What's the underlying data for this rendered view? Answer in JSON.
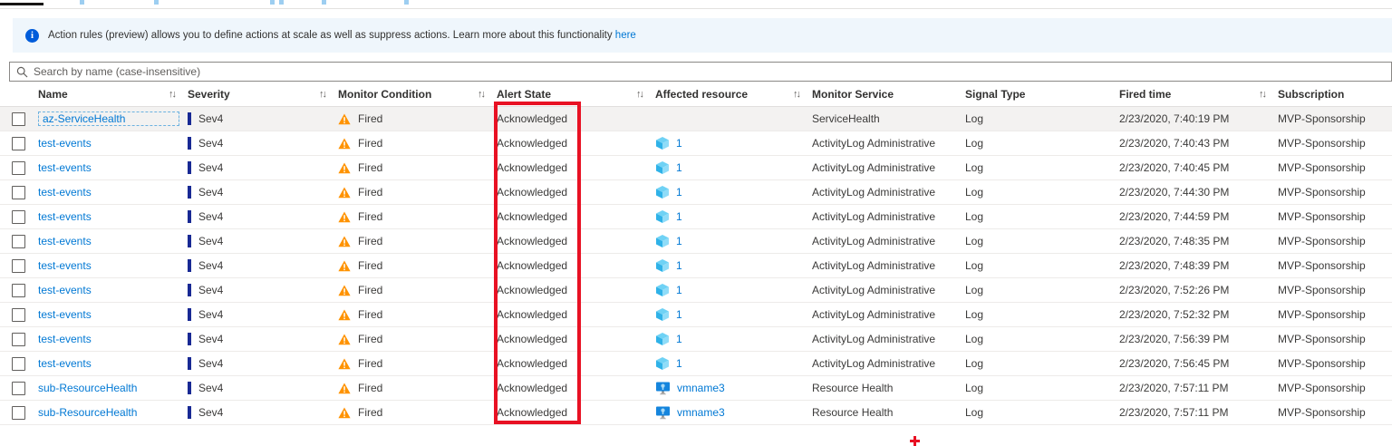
{
  "banner": {
    "message": "Action rules (preview) allows you to define actions at scale as well as suppress actions. Learn more about this functionality",
    "link_label": "here",
    "background": "#eff6fc",
    "info_icon": "info-icon"
  },
  "search": {
    "placeholder": "Search by name (case-insensitive)",
    "icon": "search-icon"
  },
  "table": {
    "sort_glyph": "↑↓",
    "columns": [
      {
        "label": "Name",
        "sortable": true
      },
      {
        "label": "Severity",
        "sortable": true
      },
      {
        "label": "Monitor Condition",
        "sortable": true
      },
      {
        "label": "Alert State",
        "sortable": true
      },
      {
        "label": "Affected resource",
        "sortable": true
      },
      {
        "label": "Monitor Service",
        "sortable": false
      },
      {
        "label": "Signal Type",
        "sortable": false
      },
      {
        "label": "Fired time",
        "sortable": true
      },
      {
        "label": "Subscription",
        "sortable": false
      }
    ],
    "rows": [
      {
        "selected": true,
        "name": "az-ServiceHealth",
        "severity": "Sev4",
        "condition": "Fired",
        "state": "Acknowledged",
        "resource": {
          "type": null,
          "label": ""
        },
        "service": "ServiceHealth",
        "signal": "Log",
        "fired": "2/23/2020, 7:40:19 PM",
        "subscription": "MVP-Sponsorship"
      },
      {
        "selected": false,
        "name": "test-events",
        "severity": "Sev4",
        "condition": "Fired",
        "state": "Acknowledged",
        "resource": {
          "type": "cube",
          "label": "1"
        },
        "service": "ActivityLog Administrative",
        "signal": "Log",
        "fired": "2/23/2020, 7:40:43 PM",
        "subscription": "MVP-Sponsorship"
      },
      {
        "selected": false,
        "name": "test-events",
        "severity": "Sev4",
        "condition": "Fired",
        "state": "Acknowledged",
        "resource": {
          "type": "cube",
          "label": "1"
        },
        "service": "ActivityLog Administrative",
        "signal": "Log",
        "fired": "2/23/2020, 7:40:45 PM",
        "subscription": "MVP-Sponsorship"
      },
      {
        "selected": false,
        "name": "test-events",
        "severity": "Sev4",
        "condition": "Fired",
        "state": "Acknowledged",
        "resource": {
          "type": "cube",
          "label": "1"
        },
        "service": "ActivityLog Administrative",
        "signal": "Log",
        "fired": "2/23/2020, 7:44:30 PM",
        "subscription": "MVP-Sponsorship"
      },
      {
        "selected": false,
        "name": "test-events",
        "severity": "Sev4",
        "condition": "Fired",
        "state": "Acknowledged",
        "resource": {
          "type": "cube",
          "label": "1"
        },
        "service": "ActivityLog Administrative",
        "signal": "Log",
        "fired": "2/23/2020, 7:44:59 PM",
        "subscription": "MVP-Sponsorship"
      },
      {
        "selected": false,
        "name": "test-events",
        "severity": "Sev4",
        "condition": "Fired",
        "state": "Acknowledged",
        "resource": {
          "type": "cube",
          "label": "1"
        },
        "service": "ActivityLog Administrative",
        "signal": "Log",
        "fired": "2/23/2020, 7:48:35 PM",
        "subscription": "MVP-Sponsorship"
      },
      {
        "selected": false,
        "name": "test-events",
        "severity": "Sev4",
        "condition": "Fired",
        "state": "Acknowledged",
        "resource": {
          "type": "cube",
          "label": "1"
        },
        "service": "ActivityLog Administrative",
        "signal": "Log",
        "fired": "2/23/2020, 7:48:39 PM",
        "subscription": "MVP-Sponsorship"
      },
      {
        "selected": false,
        "name": "test-events",
        "severity": "Sev4",
        "condition": "Fired",
        "state": "Acknowledged",
        "resource": {
          "type": "cube",
          "label": "1"
        },
        "service": "ActivityLog Administrative",
        "signal": "Log",
        "fired": "2/23/2020, 7:52:26 PM",
        "subscription": "MVP-Sponsorship"
      },
      {
        "selected": false,
        "name": "test-events",
        "severity": "Sev4",
        "condition": "Fired",
        "state": "Acknowledged",
        "resource": {
          "type": "cube",
          "label": "1"
        },
        "service": "ActivityLog Administrative",
        "signal": "Log",
        "fired": "2/23/2020, 7:52:32 PM",
        "subscription": "MVP-Sponsorship"
      },
      {
        "selected": false,
        "name": "test-events",
        "severity": "Sev4",
        "condition": "Fired",
        "state": "Acknowledged",
        "resource": {
          "type": "cube",
          "label": "1"
        },
        "service": "ActivityLog Administrative",
        "signal": "Log",
        "fired": "2/23/2020, 7:56:39 PM",
        "subscription": "MVP-Sponsorship"
      },
      {
        "selected": false,
        "name": "test-events",
        "severity": "Sev4",
        "condition": "Fired",
        "state": "Acknowledged",
        "resource": {
          "type": "cube",
          "label": "1"
        },
        "service": "ActivityLog Administrative",
        "signal": "Log",
        "fired": "2/23/2020, 7:56:45 PM",
        "subscription": "MVP-Sponsorship"
      },
      {
        "selected": false,
        "name": "sub-ResourceHealth",
        "severity": "Sev4",
        "condition": "Fired",
        "state": "Acknowledged",
        "resource": {
          "type": "vm",
          "label": "vmname3"
        },
        "service": "Resource Health",
        "signal": "Log",
        "fired": "2/23/2020, 7:57:11 PM",
        "subscription": "MVP-Sponsorship"
      },
      {
        "selected": false,
        "name": "sub-ResourceHealth",
        "severity": "Sev4",
        "condition": "Fired",
        "state": "Acknowledged",
        "resource": {
          "type": "vm",
          "label": "vmname3"
        },
        "service": "Resource Health",
        "signal": "Log",
        "fired": "2/23/2020, 7:57:11 PM",
        "subscription": "MVP-Sponsorship"
      }
    ]
  },
  "annotations": {
    "alert_state_highlight": {
      "shape": "rectangle",
      "color": "#e81123",
      "column": "Alert State"
    },
    "cross_marker": {
      "shape": "plus",
      "color": "#e81123"
    }
  },
  "colors": {
    "link": "#0078d4",
    "severity_bar": "#182994",
    "warning": "#ff9300",
    "banner_bg": "#eff6fc",
    "highlight": "#e81123"
  }
}
